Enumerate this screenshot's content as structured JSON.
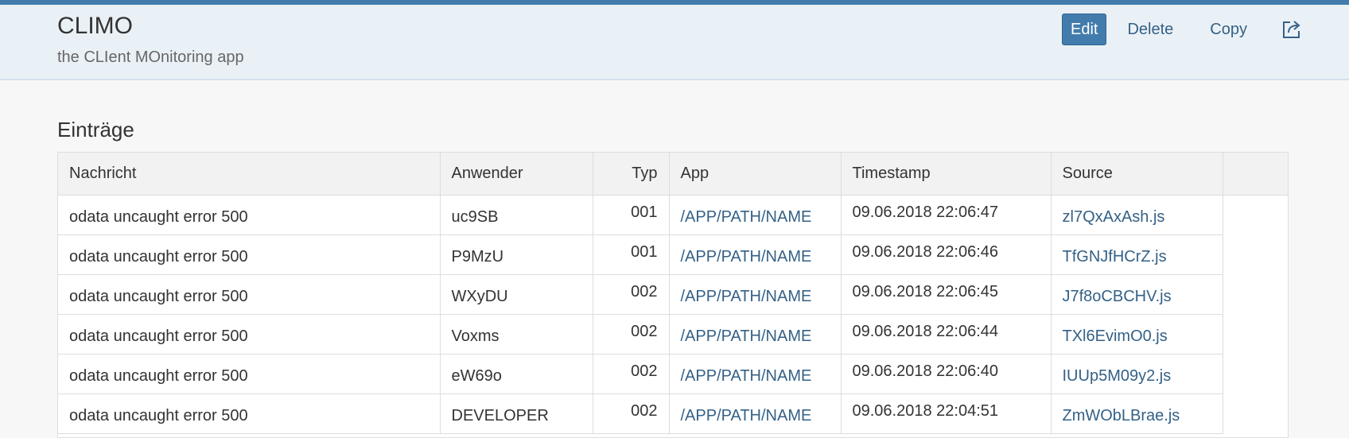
{
  "header": {
    "title": "CLIMO",
    "subtitle": "the CLIent MOnitoring app",
    "actions": {
      "edit": "Edit",
      "delete": "Delete",
      "copy": "Copy",
      "share_icon": "share-icon"
    }
  },
  "section": {
    "title": "Einträge"
  },
  "table": {
    "columns": [
      "Nachricht",
      "Anwender",
      "Typ",
      "App",
      "Timestamp",
      "Source"
    ],
    "rows": [
      {
        "message": "odata uncaught error 500",
        "user": "uc9SB",
        "type": "001",
        "app": "/APP/PATH/NAME",
        "timestamp": "09.06.2018 22:06:47",
        "source": "zl7QxAxAsh.js"
      },
      {
        "message": "odata uncaught error 500",
        "user": "P9MzU",
        "type": "001",
        "app": "/APP/PATH/NAME",
        "timestamp": "09.06.2018 22:06:46",
        "source": "TfGNJfHCrZ.js"
      },
      {
        "message": "odata uncaught error 500",
        "user": "WXyDU",
        "type": "002",
        "app": "/APP/PATH/NAME",
        "timestamp": "09.06.2018 22:06:45",
        "source": "J7f8oCBCHV.js"
      },
      {
        "message": "odata uncaught error 500",
        "user": "Voxms",
        "type": "002",
        "app": "/APP/PATH/NAME",
        "timestamp": "09.06.2018 22:06:44",
        "source": "TXl6EvimO0.js"
      },
      {
        "message": "odata uncaught error 500",
        "user": "eW69o",
        "type": "002",
        "app": "/APP/PATH/NAME",
        "timestamp": "09.06.2018 22:06:40",
        "source": "IUUp5M09y2.js"
      },
      {
        "message": "odata uncaught error 500",
        "user": "DEVELOPER",
        "type": "002",
        "app": "/APP/PATH/NAME",
        "timestamp": "09.06.2018 22:04:51",
        "source": "ZmWObLBrae.js"
      }
    ]
  },
  "colors": {
    "accent": "#427cac",
    "link": "#346187",
    "header_bg": "#eaf1f6"
  }
}
